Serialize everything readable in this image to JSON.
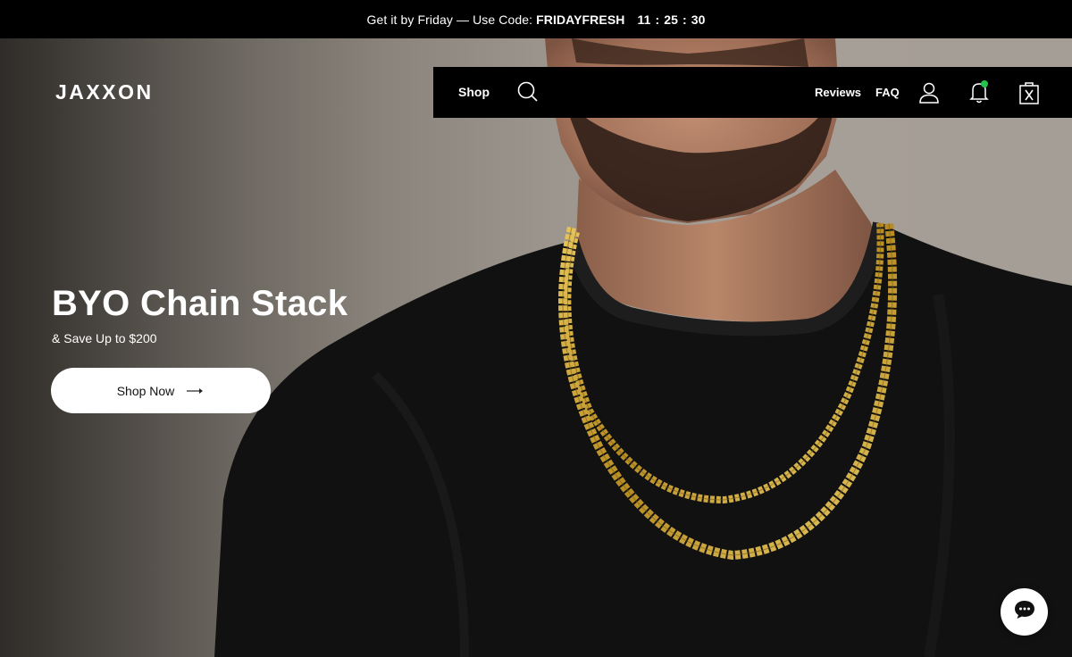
{
  "announcement": {
    "text": "Get it by Friday — Use Code:",
    "code": "FRIDAYFRESH",
    "timer": "11 : 25 : 30"
  },
  "brand": {
    "logo": "JAXXON"
  },
  "nav": {
    "shop": "Shop",
    "reviews": "Reviews",
    "faq": "FAQ",
    "icons": [
      "search-icon",
      "account-icon",
      "notification-bell-icon",
      "cart-bag-icon"
    ],
    "notification_dot_color": "#27c24c"
  },
  "hero": {
    "title": "BYO Chain Stack",
    "subtitle": "& Save Up to $200",
    "cta_label": "Shop Now"
  },
  "chat": {
    "icon": "chat-bubble-icon"
  },
  "colors": {
    "bar": "#000000",
    "text": "#ffffff",
    "chain_gold": "#c9a233",
    "sweater": "#101010"
  }
}
